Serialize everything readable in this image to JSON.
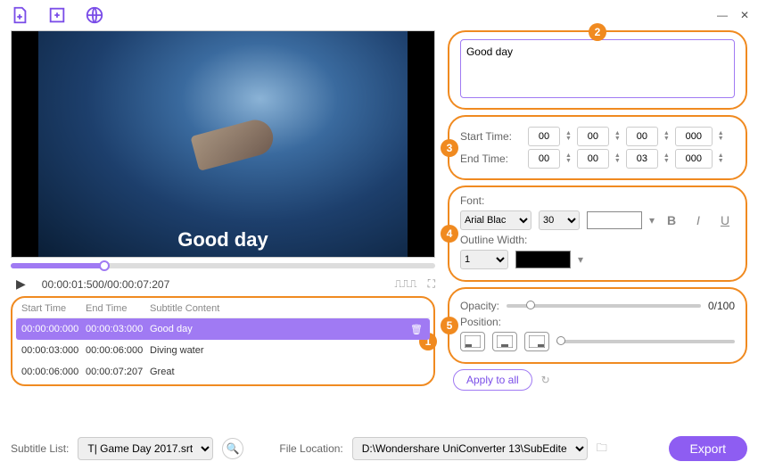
{
  "toolbar": {
    "minimize": "—",
    "close": "✕"
  },
  "video": {
    "subtitle_overlay": "Good day"
  },
  "progress": {},
  "player": {
    "time": "00:00:01:500/00:00:07:207"
  },
  "table": {
    "headers": {
      "start": "Start Time",
      "end": "End Time",
      "content": "Subtitle Content"
    },
    "rows": [
      {
        "start": "00:00:00:000",
        "end": "00:00:03:000",
        "content": "Good day",
        "selected": true
      },
      {
        "start": "00:00:03:000",
        "end": "00:00:06:000",
        "content": "Diving water"
      },
      {
        "start": "00:00:06:000",
        "end": "00:00:07:207",
        "content": "Great"
      }
    ]
  },
  "editor": {
    "text": "Good day",
    "start_label": "Start Time:",
    "end_label": "End Time:",
    "start": {
      "h": "00",
      "m": "00",
      "s": "00",
      "ms": "000"
    },
    "end": {
      "h": "00",
      "m": "00",
      "s": "03",
      "ms": "000"
    },
    "font_label": "Font:",
    "font": "Arial Blac",
    "size": "30",
    "outline_label": "Outline Width:",
    "outline": "1",
    "opacity_label": "Opacity:",
    "opacity_value": "0/100",
    "position_label": "Position:",
    "apply": "Apply to all"
  },
  "footer": {
    "subtitle_list_label": "Subtitle List:",
    "subtitle_file": "T| Game Day 2017.srt",
    "file_loc_label": "File Location:",
    "file_loc": "D:\\Wondershare UniConverter 13\\SubEdite",
    "export": "Export"
  },
  "badges": {
    "1": "1",
    "2": "2",
    "3": "3",
    "4": "4",
    "5": "5"
  }
}
